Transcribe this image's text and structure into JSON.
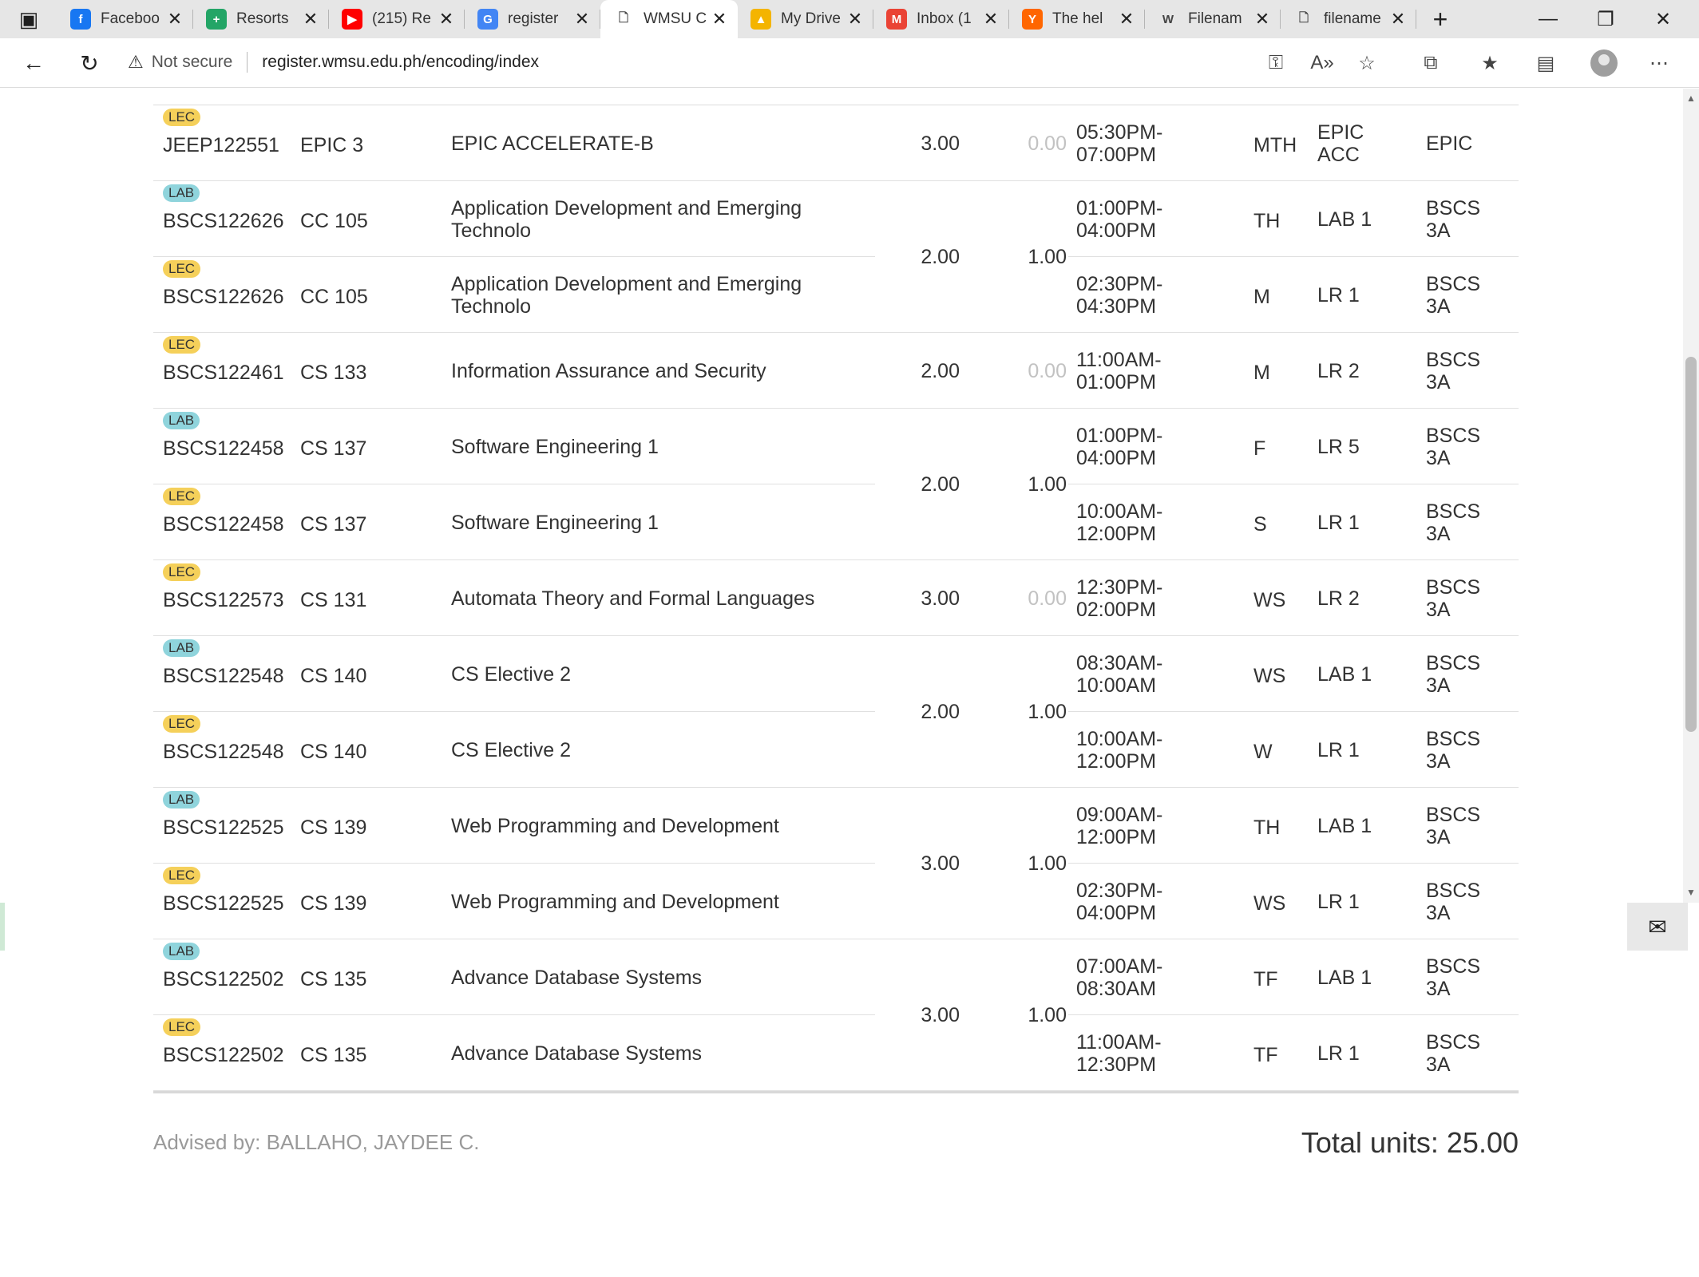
{
  "tabs": [
    {
      "title": "Faceboo",
      "icon": "facebook-icon",
      "icon_glyph": "f",
      "color": "#1877f2"
    },
    {
      "title": "Resorts",
      "icon": "sheets-icon",
      "icon_glyph": "+",
      "color": "#23a566"
    },
    {
      "title": "(215) Re",
      "icon": "youtube-icon",
      "icon_glyph": "▶",
      "color": "#ff0000"
    },
    {
      "title": "register",
      "icon": "google-icon",
      "icon_glyph": "G",
      "color": "#4285f4"
    },
    {
      "title": "WMSU C",
      "icon": "page-icon",
      "icon_glyph": "🗋",
      "color": "#ffffff"
    },
    {
      "title": "My Drive",
      "icon": "google-drive-icon",
      "icon_glyph": "▲",
      "color": "#f4b400"
    },
    {
      "title": "Inbox (1",
      "icon": "gmail-icon",
      "icon_glyph": "M",
      "color": "#ea4335"
    },
    {
      "title": "The hel",
      "icon": "ycombinator-icon",
      "icon_glyph": "Y",
      "color": "#ff6600"
    },
    {
      "title": "Filenam",
      "icon": "wikipedia-icon",
      "icon_glyph": "W",
      "color": "#ffffff"
    },
    {
      "title": "filename",
      "icon": "doc-icon",
      "icon_glyph": "🗋",
      "color": "#ffffff"
    }
  ],
  "address": {
    "security_label": "Not secure",
    "url": "register.wmsu.edu.ph/encoding/index"
  },
  "rows": [
    {
      "type": "LEC",
      "code": "JEEP122551",
      "subject": "EPIC 3",
      "description": "EPIC ACCELERATE-B",
      "time": "05:30PM-07:00PM",
      "day": "MTH",
      "room": "EPIC ACC",
      "section": "EPIC"
    },
    {
      "type": "LAB",
      "code": "BSCS122626",
      "subject": "CC 105",
      "description": "Application Development and Emerging Technolo",
      "time": "01:00PM-04:00PM",
      "day": "TH",
      "room": "LAB 1",
      "section": "BSCS 3A"
    },
    {
      "type": "LEC",
      "code": "BSCS122626",
      "subject": "CC 105",
      "description": "Application Development and Emerging Technolo",
      "time": "02:30PM-04:30PM",
      "day": "M",
      "room": "LR 1",
      "section": "BSCS 3A"
    },
    {
      "type": "LEC",
      "code": "BSCS122461",
      "subject": "CS 133",
      "description": "Information Assurance and Security",
      "time": "11:00AM-01:00PM",
      "day": "M",
      "room": "LR 2",
      "section": "BSCS 3A"
    },
    {
      "type": "LAB",
      "code": "BSCS122458",
      "subject": "CS 137",
      "description": "Software Engineering 1",
      "time": "01:00PM-04:00PM",
      "day": "F",
      "room": "LR 5",
      "section": "BSCS 3A"
    },
    {
      "type": "LEC",
      "code": "BSCS122458",
      "subject": "CS 137",
      "description": "Software Engineering 1",
      "time": "10:00AM-12:00PM",
      "day": "S",
      "room": "LR 1",
      "section": "BSCS 3A"
    },
    {
      "type": "LEC",
      "code": "BSCS122573",
      "subject": "CS 131",
      "description": "Automata Theory and Formal Languages",
      "time": "12:30PM-02:00PM",
      "day": "WS",
      "room": "LR 2",
      "section": "BSCS 3A"
    },
    {
      "type": "LAB",
      "code": "BSCS122548",
      "subject": "CS 140",
      "description": "CS Elective 2",
      "time": "08:30AM-10:00AM",
      "day": "WS",
      "room": "LAB 1",
      "section": "BSCS 3A"
    },
    {
      "type": "LEC",
      "code": "BSCS122548",
      "subject": "CS 140",
      "description": "CS Elective 2",
      "time": "10:00AM-12:00PM",
      "day": "W",
      "room": "LR 1",
      "section": "BSCS 3A"
    },
    {
      "type": "LAB",
      "code": "BSCS122525",
      "subject": "CS 139",
      "description": "Web Programming and Development",
      "time": "09:00AM-12:00PM",
      "day": "TH",
      "room": "LAB 1",
      "section": "BSCS 3A"
    },
    {
      "type": "LEC",
      "code": "BSCS122525",
      "subject": "CS 139",
      "description": "Web Programming and Development",
      "time": "02:30PM-04:00PM",
      "day": "WS",
      "room": "LR 1",
      "section": "BSCS 3A"
    },
    {
      "type": "LAB",
      "code": "BSCS122502",
      "subject": "CS 135",
      "description": "Advance Database Systems",
      "time": "07:00AM-08:30AM",
      "day": "TF",
      "room": "LAB 1",
      "section": "BSCS 3A"
    },
    {
      "type": "LEC",
      "code": "BSCS122502",
      "subject": "CS 135",
      "description": "Advance Database Systems",
      "time": "11:00AM-12:30PM",
      "day": "TF",
      "room": "LR 1",
      "section": "BSCS 3A"
    }
  ],
  "unit_groups": [
    {
      "rows": [
        0
      ],
      "lec_units": "3.00",
      "lab_units": "0.00"
    },
    {
      "rows": [
        1,
        2
      ],
      "lec_units": "2.00",
      "lab_units": "1.00"
    },
    {
      "rows": [
        3
      ],
      "lec_units": "2.00",
      "lab_units": "0.00"
    },
    {
      "rows": [
        4,
        5
      ],
      "lec_units": "2.00",
      "lab_units": "1.00"
    },
    {
      "rows": [
        6
      ],
      "lec_units": "3.00",
      "lab_units": "0.00"
    },
    {
      "rows": [
        7,
        8
      ],
      "lec_units": "2.00",
      "lab_units": "1.00"
    },
    {
      "rows": [
        9,
        10
      ],
      "lec_units": "3.00",
      "lab_units": "1.00"
    },
    {
      "rows": [
        11,
        12
      ],
      "lec_units": "3.00",
      "lab_units": "1.00"
    }
  ],
  "footer": {
    "advised_by": "Advised by: BALLAHO, JAYDEE C.",
    "total_units": "Total units: 25.00"
  }
}
